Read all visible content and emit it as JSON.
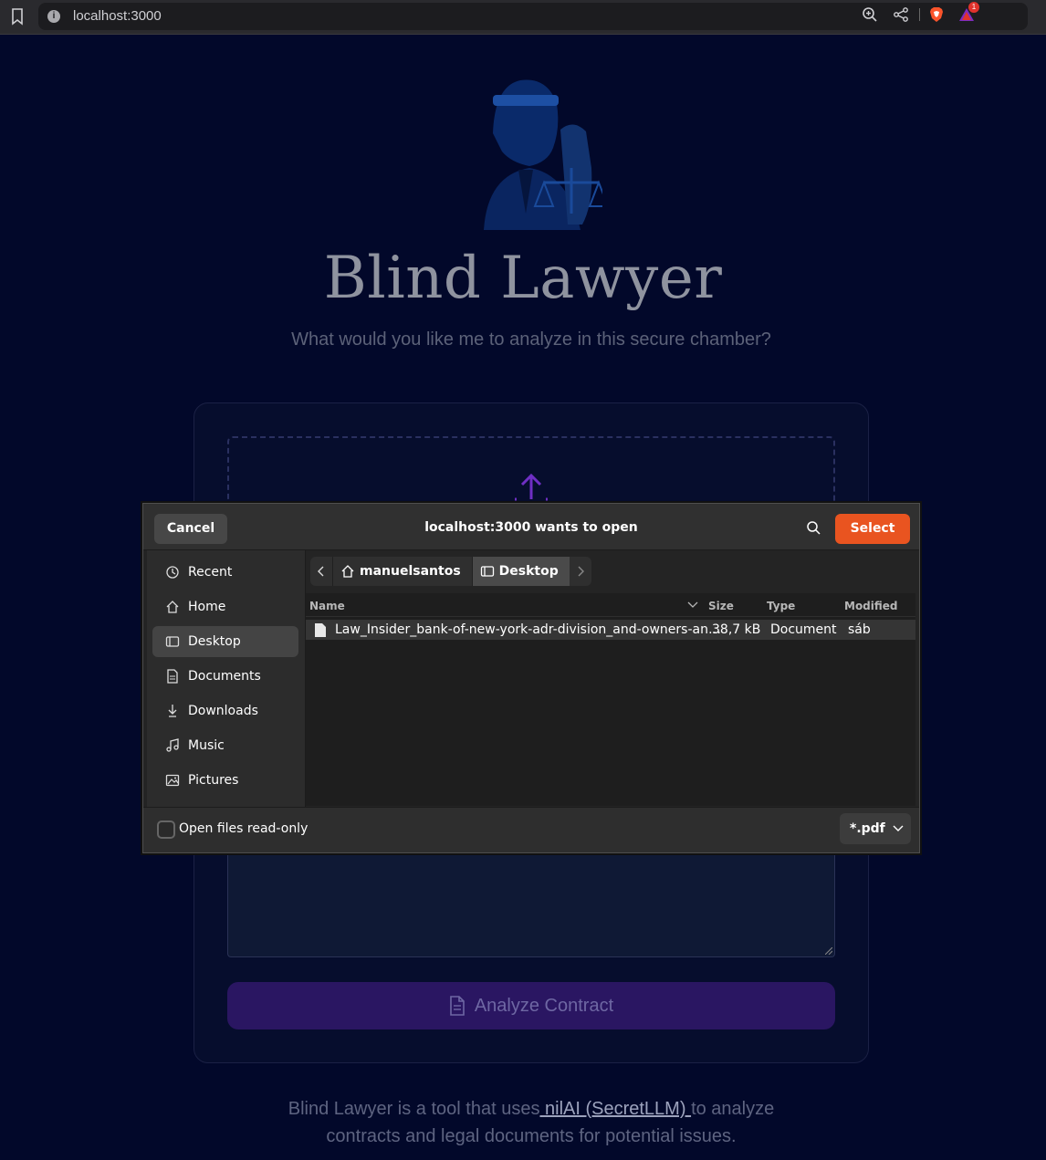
{
  "browser": {
    "url": "localhost:3000",
    "rewards_count": "1"
  },
  "page": {
    "title": "Blind Lawyer",
    "subtitle": "What would you like me to analyze in this secure chamber?",
    "analyze_label": "Analyze Contract",
    "footer_pre": "Blind Lawyer is a tool that uses",
    "footer_link": " nilAI (SecretLLM) ",
    "footer_post": "to analyze",
    "footer_line2": "contracts and legal documents for potential issues."
  },
  "dialog": {
    "cancel_label": "Cancel",
    "title": "localhost:3000 wants to open",
    "select_label": "Select",
    "sidebar": [
      {
        "label": "Recent",
        "icon": "clock-icon"
      },
      {
        "label": "Home",
        "icon": "home-icon"
      },
      {
        "label": "Desktop",
        "icon": "desktop-icon",
        "active": true
      },
      {
        "label": "Documents",
        "icon": "document-icon"
      },
      {
        "label": "Downloads",
        "icon": "download-icon"
      },
      {
        "label": "Music",
        "icon": "music-icon"
      },
      {
        "label": "Pictures",
        "icon": "picture-icon"
      }
    ],
    "path": [
      "manuelsantos",
      "Desktop"
    ],
    "columns": {
      "name": "Name",
      "size": "Size",
      "type": "Type",
      "modified": "Modified"
    },
    "files": [
      {
        "name": "Law_Insider_bank-of-new-york-adr-division_and-owners-an…",
        "size": "38,7 kB",
        "type": "Document",
        "modified": "sáb"
      }
    ],
    "readonly_label": "Open files read-only",
    "filter": "*.pdf"
  },
  "colors": {
    "accent": "#e95420",
    "page_bg": "#02082a",
    "analyze_bg": "#2a1662"
  }
}
